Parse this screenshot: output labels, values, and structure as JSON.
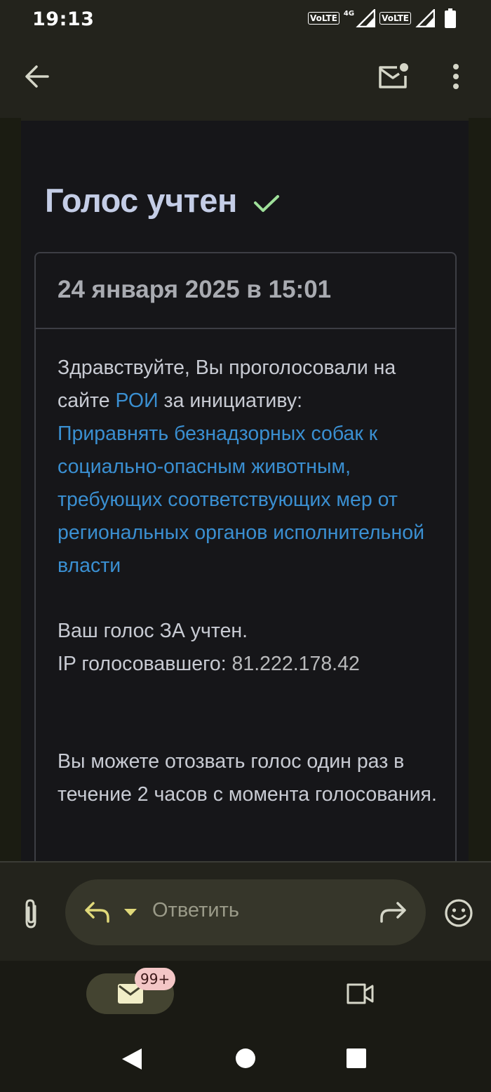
{
  "status_bar": {
    "time": "19:13",
    "volte1": "VoLTE",
    "net_type": "4G",
    "volte2": "VoLTE",
    "icons": [
      "signal-icon",
      "signal-icon",
      "battery-icon"
    ]
  },
  "app_bar": {
    "icons": [
      "back-arrow-icon",
      "mark-unread-icon",
      "more-vert-icon"
    ]
  },
  "email": {
    "heading": "Голос учтен",
    "date": "24 января 2025 в 15:01",
    "greeting_prefix": "Здравствуйте, Вы проголосовали на сайте ",
    "site_link": "РОИ",
    "greeting_suffix": " за инициативу:",
    "initiative_link": "Приравнять безнадзорных собак к социально-опасным животным, требующих соответствующих мер от региональных органов исполнительной власти",
    "vote_status": "Ваш голос ЗА учтен.",
    "ip_label": "IP голосовавшего: ",
    "ip_value": "81.222.178.42",
    "revoke_note": "Вы можете отозвать голос один раз в течение 2 часов с момента голосования.",
    "colors": {
      "link": "#3a8fd1",
      "check": "#9fe09a",
      "heading": "#c4cde6"
    }
  },
  "reply_bar": {
    "placeholder": "Ответить",
    "icons": [
      "attach-icon",
      "reply-icon",
      "dropdown-icon",
      "forward-icon",
      "emoji-icon"
    ]
  },
  "bottom_nav": {
    "mail_badge": "99+",
    "icons": [
      "mail-icon",
      "video-icon"
    ]
  },
  "system_nav": {
    "icons": [
      "nav-back-icon",
      "nav-home-icon",
      "nav-recent-icon"
    ]
  }
}
